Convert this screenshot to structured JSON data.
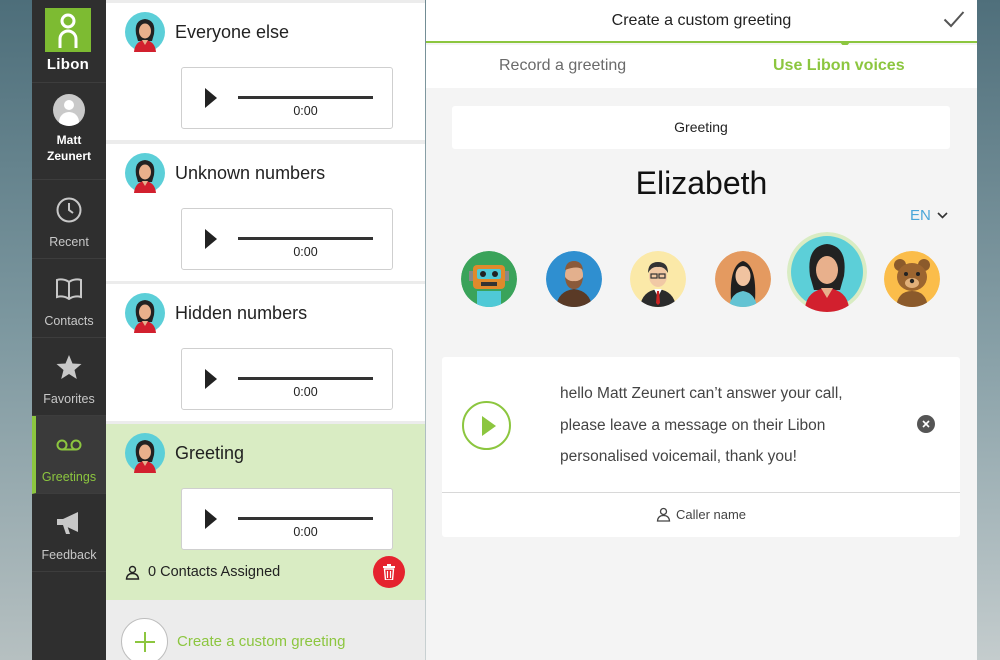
{
  "app": {
    "brand": "Libon"
  },
  "colors": {
    "accent": "#8cc63f",
    "sidebar": "#2f2f2f",
    "danger": "#e5232e",
    "link": "#4aa6d9"
  },
  "sidebar": {
    "user": {
      "name_first": "Matt",
      "name_last": "Zeunert"
    },
    "items": [
      {
        "label": "Recent",
        "icon": "clock-icon"
      },
      {
        "label": "Contacts",
        "icon": "book-icon"
      },
      {
        "label": "Favorites",
        "icon": "star-icon"
      },
      {
        "label": "Greetings",
        "icon": "voicemail-icon",
        "active": true
      },
      {
        "label": "Feedback",
        "icon": "megaphone-icon"
      }
    ]
  },
  "greetings_list": [
    {
      "title": "Everyone else",
      "time": "0:00"
    },
    {
      "title": "Unknown numbers",
      "time": "0:00"
    },
    {
      "title": "Hidden numbers",
      "time": "0:00"
    },
    {
      "title": "Greeting",
      "time": "0:00",
      "assigned": "0 Contacts Assigned",
      "selected": true
    }
  ],
  "create_label": "Create a custom greeting",
  "panel": {
    "title": "Create a custom greeting",
    "tabs": {
      "record": "Record a greeting",
      "voices": "Use Libon voices"
    },
    "greeting_field": "Greeting",
    "voice_name": "Elizabeth",
    "language": "EN",
    "voices": [
      "robot",
      "bearded-man",
      "businessman",
      "long-hair-woman",
      "elizabeth",
      "teddy-bear"
    ],
    "selected_voice": "elizabeth",
    "message": "hello Matt Zeunert can’t answer your call, please leave a message on their Libon personalised voicemail, thank you!",
    "caller_name_label": "Caller name"
  }
}
